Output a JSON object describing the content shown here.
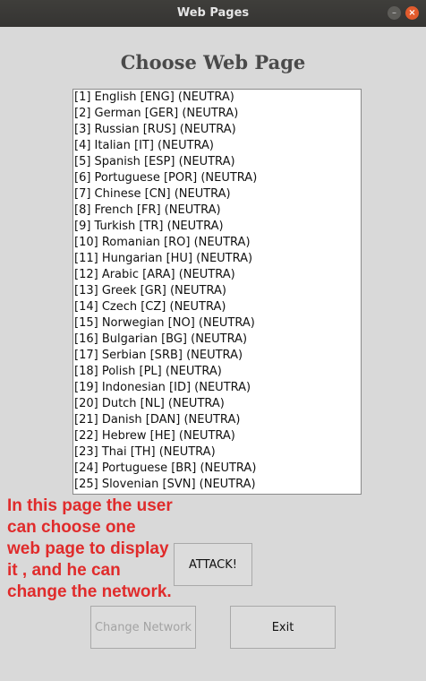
{
  "window": {
    "title": "Web Pages",
    "minimize_symbol": "–",
    "close_symbol": "×"
  },
  "heading": "Choose Web Page",
  "web_pages": [
    "[1] English [ENG] (NEUTRA)",
    "[2] German [GER] (NEUTRA)",
    "[3] Russian [RUS] (NEUTRA)",
    "[4] Italian [IT] (NEUTRA)",
    "[5] Spanish [ESP] (NEUTRA)",
    "[6] Portuguese [POR] (NEUTRA)",
    "[7] Chinese [CN] (NEUTRA)",
    "[8] French [FR] (NEUTRA)",
    "[9] Turkish [TR] (NEUTRA)",
    "[10] Romanian [RO] (NEUTRA)",
    "[11] Hungarian [HU] (NEUTRA)",
    "[12] Arabic [ARA] (NEUTRA)",
    "[13] Greek [GR] (NEUTRA)",
    "[14] Czech [CZ] (NEUTRA)",
    "[15] Norwegian [NO] (NEUTRA)",
    "[16] Bulgarian [BG] (NEUTRA)",
    "[17] Serbian [SRB] (NEUTRA)",
    "[18] Polish [PL] (NEUTRA)",
    "[19] Indonesian [ID] (NEUTRA)",
    "[20] Dutch [NL] (NEUTRA)",
    "[21] Danish [DAN] (NEUTRA)",
    "[22] Hebrew [HE] (NEUTRA)",
    "[23] Thai [TH] (NEUTRA)",
    "[24] Portuguese [BR] (NEUTRA)",
    "[25] Slovenian [SVN] (NEUTRA)"
  ],
  "annotation": "In this page the user can choose one web page to display it , and he can change the network.",
  "buttons": {
    "attack": "ATTACK!",
    "change_network": "Change Network",
    "exit": "Exit"
  },
  "colors": {
    "window_bg": "#d9d9d9",
    "titlebar": "#3a3936",
    "close_button": "#e25b2d",
    "annotation": "#e02b2b",
    "disabled_text": "#a3a3a3"
  }
}
